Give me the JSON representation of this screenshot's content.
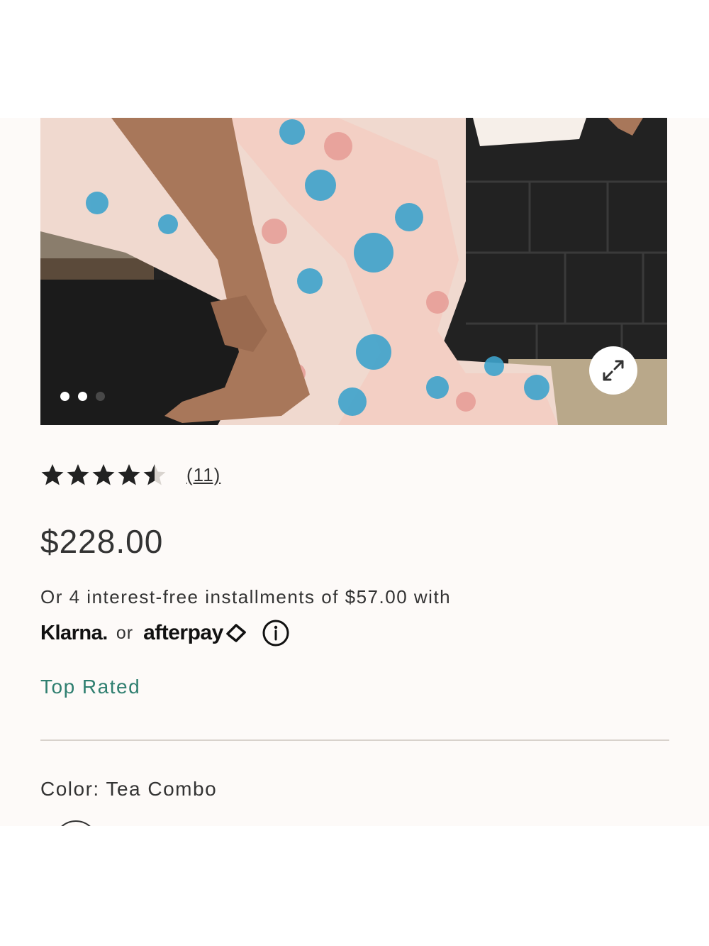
{
  "gallery": {
    "image_alt": "Floral maxi dress product photo",
    "slide_count": 3,
    "active_slide": 2,
    "expand_icon": "expand-arrows-icon"
  },
  "rating": {
    "stars": 4.5,
    "max_stars": 5,
    "review_count": "(11)"
  },
  "price": "$228.00",
  "installments": {
    "text": "Or 4 interest-free installments of $57.00 with",
    "klarna": "Klarna.",
    "or": "or",
    "afterpay": "afterpay",
    "afterpay_icon": "afterpay-arrows-icon",
    "info_icon": "info-icon"
  },
  "badge": "Top Rated",
  "color": {
    "label": "Color: Tea Combo"
  },
  "colors": {
    "background": "#fdfaf8",
    "accent_green": "#2f7f70",
    "text": "#333333"
  }
}
